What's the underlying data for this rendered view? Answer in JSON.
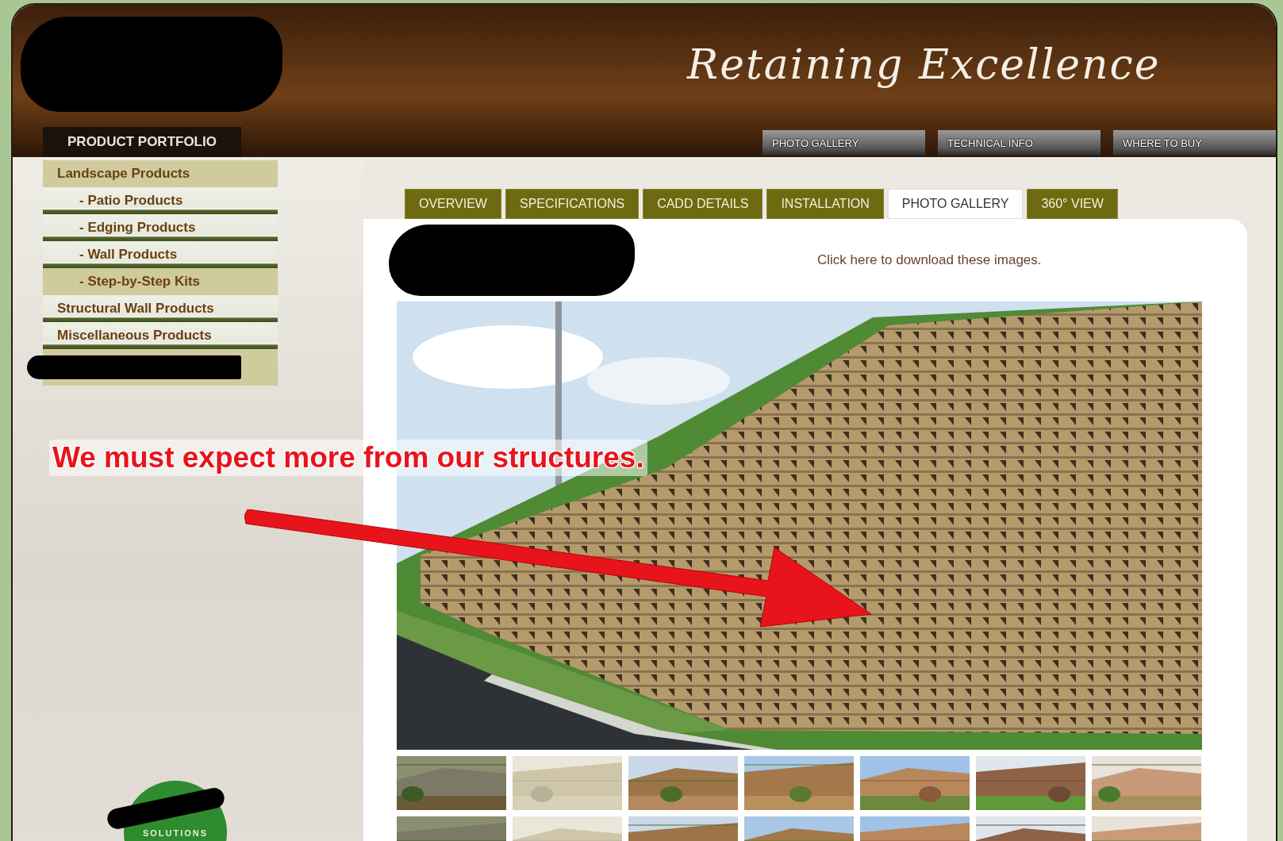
{
  "header": {
    "title": "Retaining Excellence",
    "portfolio_tab": "PRODUCT PORTFOLIO",
    "nav": [
      "PHOTO GALLERY",
      "TECHNICAL INFO",
      "WHERE TO BUY"
    ]
  },
  "sidebar": {
    "items": [
      {
        "label": "Landscape Products",
        "kind": "category",
        "selected": true
      },
      {
        "label": "- Patio Products",
        "kind": "sub",
        "selected": false
      },
      {
        "label": "- Edging Products",
        "kind": "sub",
        "selected": false
      },
      {
        "label": "- Wall Products",
        "kind": "sub",
        "selected": false
      },
      {
        "label": "- Step-by-Step Kits",
        "kind": "sub",
        "selected": true
      },
      {
        "label": "Structural Wall Products",
        "kind": "category",
        "selected": false
      },
      {
        "label": "Miscellaneous Products",
        "kind": "category",
        "selected": false
      }
    ]
  },
  "logo": {
    "text": "SOLUTIONS"
  },
  "tabs": [
    {
      "label": "OVERVIEW",
      "selected": false
    },
    {
      "label": "SPECIFICATIONS",
      "selected": false
    },
    {
      "label": "CADD DETAILS",
      "selected": false
    },
    {
      "label": "INSTALLATION",
      "selected": false
    },
    {
      "label": "PHOTO GALLERY",
      "selected": true
    },
    {
      "label": "360° VIEW",
      "selected": false
    }
  ],
  "content": {
    "download_link": "Click here to download these images."
  },
  "annotation": {
    "text": "We must expect more from our structures."
  }
}
